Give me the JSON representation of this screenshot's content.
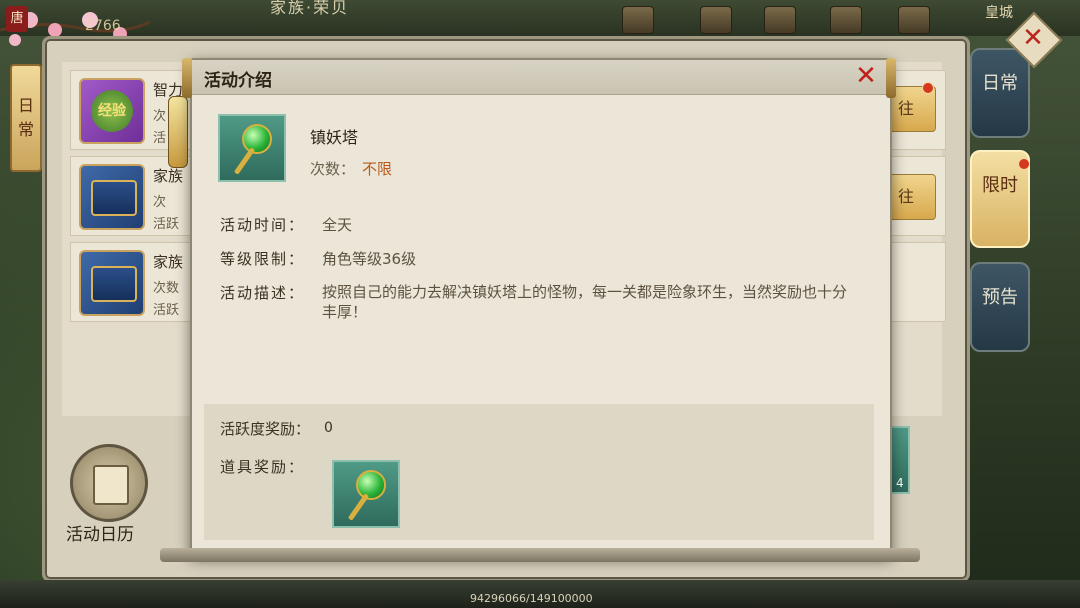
{
  "top": {
    "title": "家族·荣贝",
    "power": "2766",
    "server": "皇城",
    "avatar_tag": "唐"
  },
  "left_tab": {
    "label": "日常"
  },
  "side_tabs": [
    {
      "label": "日常",
      "active": false
    },
    {
      "label": "限时",
      "active": true
    },
    {
      "label": "预告",
      "active": false
    }
  ],
  "background_list": [
    {
      "title": "智力",
      "line1": "次",
      "line2": "活",
      "icon": "exp-badge-icon",
      "badge": "经验",
      "btn": "往"
    },
    {
      "title": "家族",
      "line1": "次",
      "line2": "活跃",
      "icon": "chest-icon",
      "btn": "往"
    },
    {
      "title": "家族",
      "line1": "次数",
      "line2": "活跃",
      "icon": "chest-icon",
      "btn": ""
    }
  ],
  "bottom": {
    "calendar_label": "活动日历",
    "exp_text": "94296066/149100000",
    "reward_count": "4"
  },
  "dialog": {
    "title": "活动介绍",
    "item_name": "镇妖塔",
    "count_label": "次数：",
    "count_value": "不限",
    "time_label": "活动时间：",
    "time_value": "全天",
    "level_label": "等级限制：",
    "level_value": "角色等级36级",
    "desc_label": "活动描述：",
    "desc_value": "按照自己的能力去解决镇妖塔上的怪物，每一关都是险象环生，当然奖励也十分丰厚！",
    "activity_reward_label": "活跃度奖励：",
    "activity_reward_value": "0",
    "item_reward_label": "道具奖励：",
    "item_icon": "jade-scepter-icon"
  },
  "colors": {
    "accent_orange": "#b85a1c",
    "close_red": "#c0201b",
    "tab_gold": "#d9b264"
  }
}
